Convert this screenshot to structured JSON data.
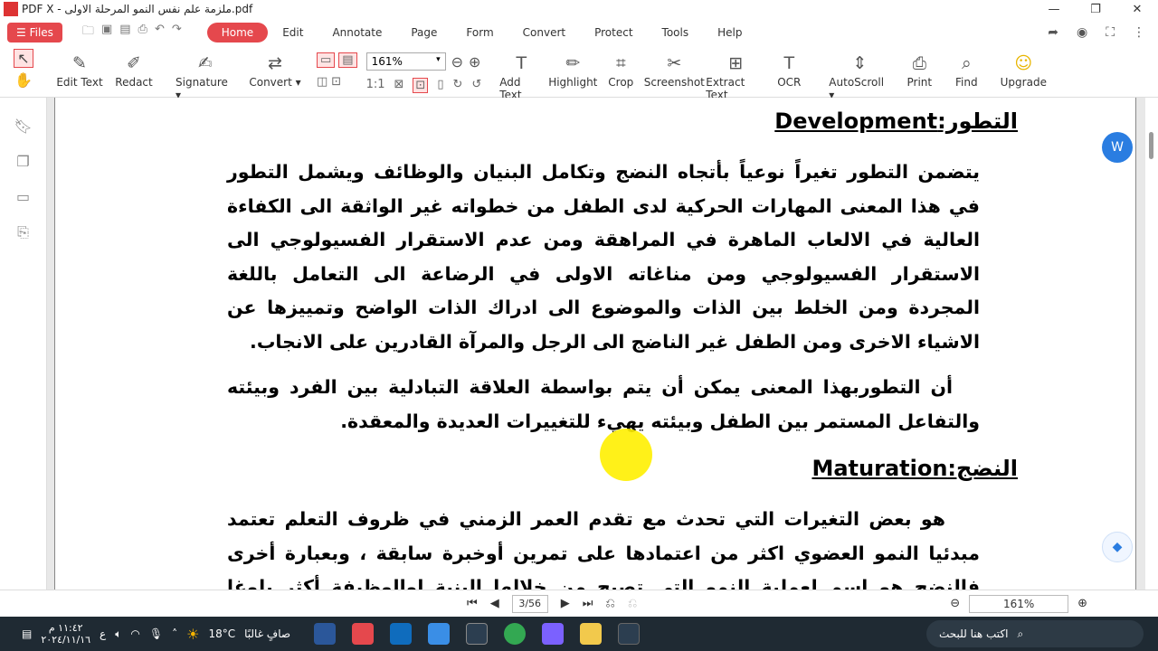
{
  "window": {
    "title": "PDF X - ملزمة علم نفس النمو المرحلة الاولى.pdf",
    "controls": [
      "—",
      "❐",
      "✕"
    ]
  },
  "menubar": {
    "files_label": "Files",
    "items": [
      "Home",
      "Edit",
      "Annotate",
      "Page",
      "Form",
      "Convert",
      "Protect",
      "Tools",
      "Help"
    ],
    "active": "Home"
  },
  "ribbon": {
    "tools": [
      {
        "label": "Edit Text",
        "icon": "edit-text-icon",
        "glyph": "✎"
      },
      {
        "label": "Redact",
        "icon": "redact-icon",
        "glyph": "✐"
      },
      {
        "label": "Signature ▾",
        "icon": "signature-icon",
        "glyph": "✍"
      },
      {
        "label": "Convert ▾",
        "icon": "convert-icon",
        "glyph": "⇄"
      }
    ],
    "zoom_value": "161%",
    "tools_right": [
      {
        "label": "Add Text",
        "icon": "add-text-icon",
        "glyph": "T"
      },
      {
        "label": "Highlight",
        "icon": "highlight-icon",
        "glyph": "✏"
      },
      {
        "label": "Crop",
        "icon": "crop-icon",
        "glyph": "⌗"
      },
      {
        "label": "Screenshot",
        "icon": "screenshot-icon",
        "glyph": "✂"
      },
      {
        "label": "Extract Text",
        "icon": "extract-text-icon",
        "glyph": "⊞"
      },
      {
        "label": "OCR",
        "icon": "ocr-icon",
        "glyph": "T"
      },
      {
        "label": "AutoScroll ▾",
        "icon": "autoscroll-icon",
        "glyph": "⇕"
      },
      {
        "label": "Print",
        "icon": "print-icon",
        "glyph": "⎙"
      },
      {
        "label": "Find",
        "icon": "find-icon",
        "glyph": "⌕"
      },
      {
        "label": "Upgrade",
        "icon": "upgrade-icon",
        "glyph": "☺"
      }
    ]
  },
  "document": {
    "heading1": "التطور:Development",
    "para1": "يتضمن التطور تغيراً نوعياً بأتجاه النضج وتكامل البنيان والوظائف ويشمل التطور في هذا المعنى المهارات الحركية لدى الطفل من خطواته غير الواثقة الى الكفاءة العالية في الالعاب الماهرة في المراهقة ومن عدم الاستقرار الفسيولوجي الى الاستقرار الفسيولوجي ومن مناغاته الاولى في الرضاعة الى التعامل باللغة المجردة ومن الخلط بين الذات والموضوع الى ادراك الذات الواضح وتمييزها عن الاشياء الاخرى ومن الطفل غير الناضج الى الرجل والمرآة القادرين على الانجاب.",
    "para2": "أن التطوربهذا المعنى يمكن أن يتم بواسطة العلاقة التبادلية بين الفرد وبيئته والتفاعل المستمر بين الطفل وبيئته يهيء للتغييرات العديدة والمعقدة.",
    "heading2": "النضج:Maturation",
    "para3": "هو بعض التغيرات التي تحدث مع تقدم العمر الزمني في ظروف التعلم تعتمد مبدئيا النمو العضوي اكثر من اعتمادها على تمرين أوخبرة سابقة ، وبعبارة أخرى فالنضج هو اسم لعملية النمو التي تصبح من خلالها البنية اوالوظيفة أكثر بلوغا وبتضمن النضج عمليات"
  },
  "statusbar": {
    "page_indicator": "3/56",
    "zoom": "161%"
  },
  "taskbar": {
    "time": "١١:٤٢ م",
    "date": "٢٠٢٤/١١/١٦",
    "weather": "18°C",
    "weather_text": "صافٍ غالبًا",
    "search_placeholder": "اكتب هنا للبحث",
    "lang": "ع"
  }
}
